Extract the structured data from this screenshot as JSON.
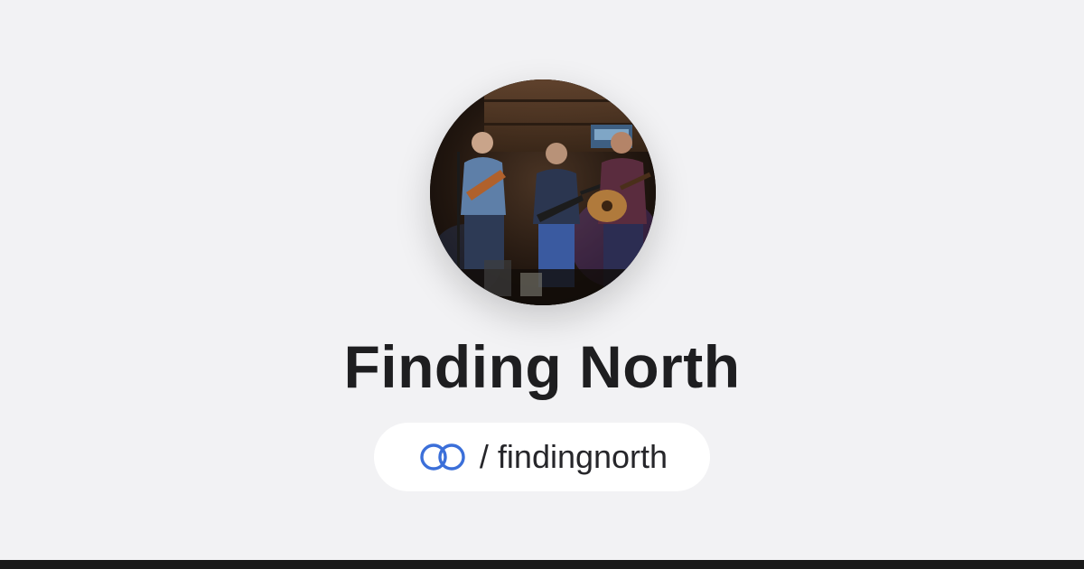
{
  "profile": {
    "name": "Finding North",
    "handle": "/ findingnorth",
    "avatar_description_icon": "band-photo-avatar"
  },
  "brand": {
    "logo_icon": "linked-rings-logo-icon",
    "logo_color": "#3b6fd9",
    "background_color": "#f2f2f4",
    "text_color": "#1e1e20",
    "pill_color": "#ffffff",
    "footer_bar_color": "#1a1a1a"
  }
}
